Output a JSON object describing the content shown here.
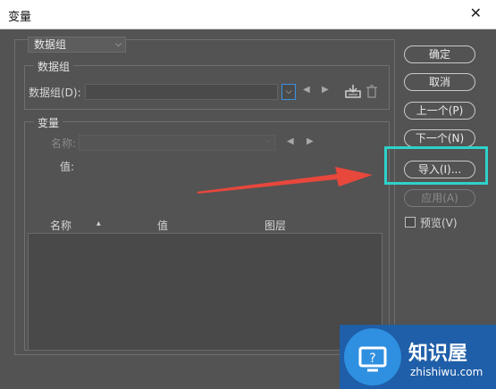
{
  "window": {
    "title": "变量",
    "close_glyph": "✕"
  },
  "top_select": {
    "value": "数据组"
  },
  "dataset_group": {
    "legend": "数据组",
    "label": "数据组(D):",
    "field_value": ""
  },
  "variable_group": {
    "legend": "变量",
    "name_label": "名称:",
    "value_label": "值:",
    "columns": [
      "名称",
      "值",
      "图层"
    ],
    "sort_indicator": "▲",
    "rows": []
  },
  "buttons": {
    "ok": "确定",
    "cancel": "取消",
    "prev": "上一个(P)",
    "next": "下一个(N)",
    "import": "导入(I)...",
    "apply": "应用(A)"
  },
  "preview": {
    "label": "预览(V)",
    "checked": false
  },
  "watermark": {
    "brand": "知识屋",
    "url": "zhishiwu.com"
  },
  "colors": {
    "dialog_bg": "#535353",
    "highlight_box": "#2ed1c9",
    "annotation_arrow": "#e8473c",
    "watermark_bg": "#1f5ea8"
  }
}
